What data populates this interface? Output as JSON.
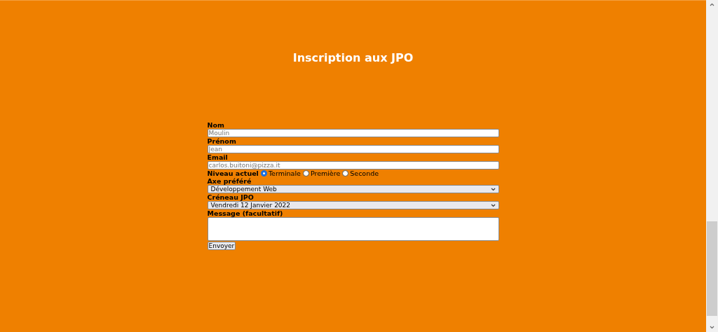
{
  "title": "Inscription aux JPO",
  "fields": [
    {
      "kind": "text",
      "label": "Nom",
      "placeholder": "Moulin"
    },
    {
      "kind": "text",
      "label": "Prénom",
      "placeholder": "Jean"
    },
    {
      "kind": "text",
      "label": "Email",
      "placeholder": "carlos.buitoni@pizza.it"
    },
    {
      "kind": "radio",
      "label": "Niveau actuel",
      "options": [
        {
          "label": "Terminale",
          "selected": true
        },
        {
          "label": "Première",
          "selected": false
        },
        {
          "label": "Seconde",
          "selected": false
        }
      ]
    },
    {
      "kind": "select",
      "label": "Axe préféré",
      "value": "Développement Web"
    },
    {
      "kind": "select",
      "label": "Créneau JPO",
      "value": "Vendredi 12 Janvier 2022"
    },
    {
      "kind": "textarea",
      "label": "Message (facultatif)"
    }
  ],
  "submit": "Envoyer"
}
